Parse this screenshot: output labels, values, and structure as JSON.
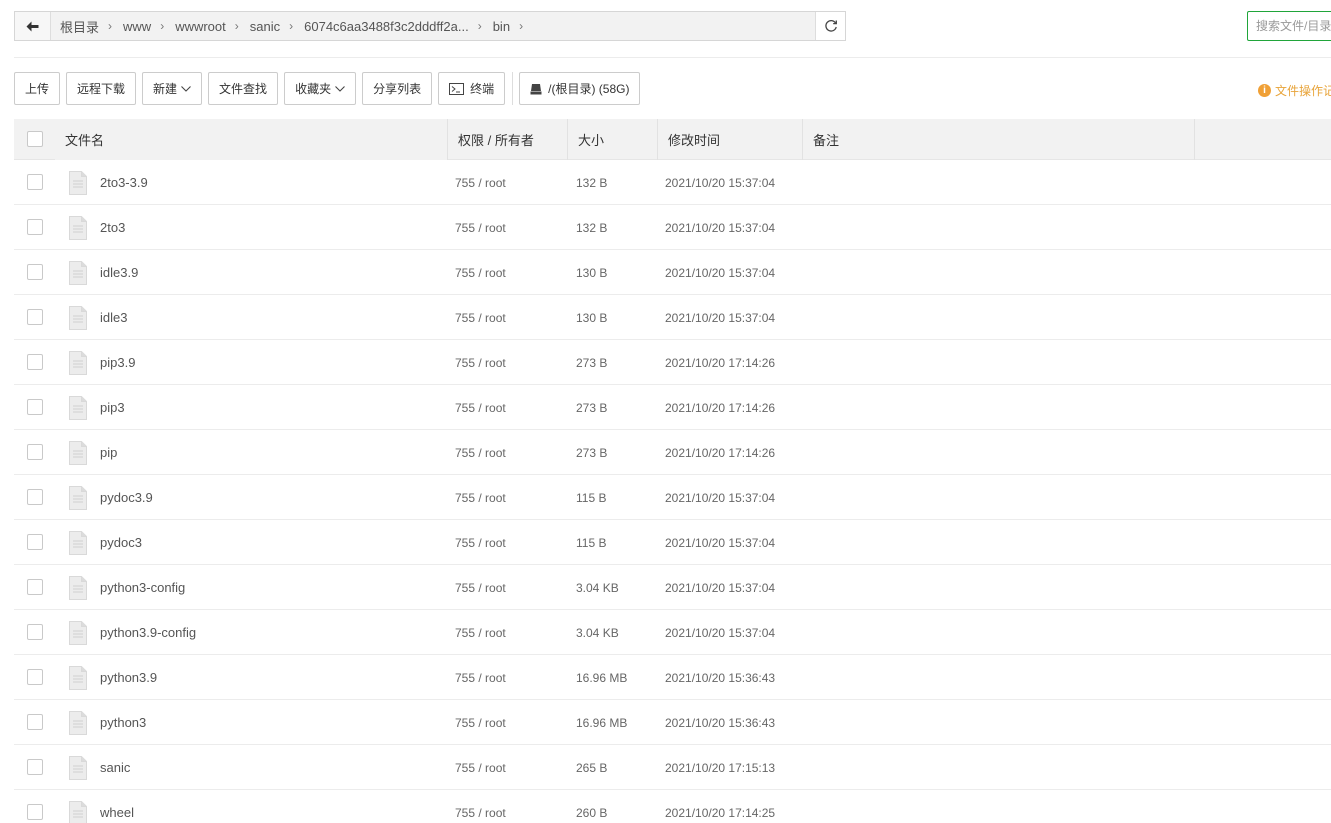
{
  "path": {
    "crumbs": [
      "根目录",
      "www",
      "wwwroot",
      "sanic",
      "6074c6aa3488f3c2dddff2a...",
      "bin"
    ]
  },
  "search": {
    "placeholder": "搜索文件/目录"
  },
  "toolbar": {
    "upload": "上传",
    "remote_download": "远程下载",
    "new": "新建",
    "file_search": "文件查找",
    "favorites": "收藏夹",
    "share_list": "分享列表",
    "terminal": "终端",
    "disk": "/(根目录) (58G)"
  },
  "file_ops_link": "文件操作记录",
  "table": {
    "columns": {
      "name": "文件名",
      "perm": "权限 / 所有者",
      "size": "大小",
      "mtime": "修改时间",
      "note": "备注"
    },
    "rows": [
      {
        "name": "2to3-3.9",
        "perm": "755 / root",
        "size": "132 B",
        "mtime": "2021/10/20 15:37:04"
      },
      {
        "name": "2to3",
        "perm": "755 / root",
        "size": "132 B",
        "mtime": "2021/10/20 15:37:04"
      },
      {
        "name": "idle3.9",
        "perm": "755 / root",
        "size": "130 B",
        "mtime": "2021/10/20 15:37:04"
      },
      {
        "name": "idle3",
        "perm": "755 / root",
        "size": "130 B",
        "mtime": "2021/10/20 15:37:04"
      },
      {
        "name": "pip3.9",
        "perm": "755 / root",
        "size": "273 B",
        "mtime": "2021/10/20 17:14:26"
      },
      {
        "name": "pip3",
        "perm": "755 / root",
        "size": "273 B",
        "mtime": "2021/10/20 17:14:26"
      },
      {
        "name": "pip",
        "perm": "755 / root",
        "size": "273 B",
        "mtime": "2021/10/20 17:14:26"
      },
      {
        "name": "pydoc3.9",
        "perm": "755 / root",
        "size": "115 B",
        "mtime": "2021/10/20 15:37:04"
      },
      {
        "name": "pydoc3",
        "perm": "755 / root",
        "size": "115 B",
        "mtime": "2021/10/20 15:37:04"
      },
      {
        "name": "python3-config",
        "perm": "755 / root",
        "size": "3.04 KB",
        "mtime": "2021/10/20 15:37:04"
      },
      {
        "name": "python3.9-config",
        "perm": "755 / root",
        "size": "3.04 KB",
        "mtime": "2021/10/20 15:37:04"
      },
      {
        "name": "python3.9",
        "perm": "755 / root",
        "size": "16.96 MB",
        "mtime": "2021/10/20 15:36:43"
      },
      {
        "name": "python3",
        "perm": "755 / root",
        "size": "16.96 MB",
        "mtime": "2021/10/20 15:36:43"
      },
      {
        "name": "sanic",
        "perm": "755 / root",
        "size": "265 B",
        "mtime": "2021/10/20 17:15:13"
      },
      {
        "name": "wheel",
        "perm": "755 / root",
        "size": "260 B",
        "mtime": "2021/10/20 17:14:25"
      }
    ]
  }
}
